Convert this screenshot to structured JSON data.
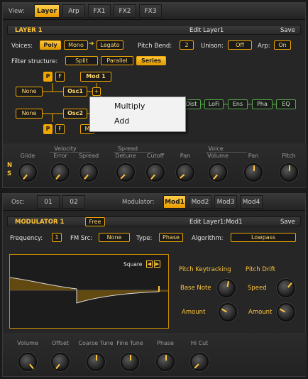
{
  "top_tabs": {
    "view_label": "View:",
    "tabs": [
      "Layer",
      "Arp",
      "FX1",
      "FX2",
      "FX3"
    ],
    "active": "Layer"
  },
  "layer": {
    "title": "LAYER 1",
    "edit_label": "Edit Layer1",
    "save": "Save",
    "voices_label": "Voices:",
    "voices": [
      "Poly",
      "Mono",
      "Legato"
    ],
    "pitch_bend_label": "Pitch Bend:",
    "pitch_bend": "2",
    "unison_label": "Unison:",
    "unison": "Off",
    "arp_label": "Arp:",
    "arp": "On",
    "filter_label": "Filter structure:",
    "filter_opts": [
      "Split",
      "Parallel",
      "Series"
    ],
    "filter_active": "Series"
  },
  "routing": {
    "p": "P",
    "f": "F",
    "mod1": "Mod 1",
    "none1": "None",
    "osc1": "Osc1",
    "plus": "+",
    "none2": "None",
    "osc2": "Osc2",
    "m": "M",
    "chain": [
      "Dist",
      "LoFi",
      "Ens",
      "Pha",
      "EQ"
    ]
  },
  "context_menu": {
    "items": [
      "Multiply",
      "Add"
    ]
  },
  "knobs1": {
    "groups": [
      "Velocity",
      "Spread",
      "Voice"
    ],
    "labels": [
      "Glide",
      "Error",
      "Spread",
      "Detune",
      "Cutoff",
      "Pan",
      "Volume",
      "Pan",
      "Pitch"
    ],
    "side": [
      "N",
      "S"
    ]
  },
  "osc_tabs": {
    "osc_label": "Osc:",
    "osc": [
      "01",
      "02"
    ],
    "mod_label": "Modulator:",
    "mods": [
      "Mod1",
      "Mod2",
      "Mod3",
      "Mod4"
    ],
    "active": "Mod1"
  },
  "modulator": {
    "title": "MODULATOR 1",
    "free": "Free",
    "edit_label": "Edit Layer1:Mod1",
    "save": "Save",
    "freq_label": "Frequency:",
    "freq": "1",
    "fm_label": "FM Src:",
    "fm": "None",
    "type_label": "Type:",
    "type": "Phase",
    "algo_label": "Algorithm:",
    "algo": "Lowpass",
    "wave": "Square",
    "pk_label": "Pitch Keytracking",
    "pd_label": "Pitch Drift",
    "base_note": "Base Note",
    "speed": "Speed",
    "amount1": "Amount",
    "amount2": "Amount"
  },
  "knobs2": {
    "labels": [
      "Volume",
      "Offset",
      "Coarse Tune",
      "Fine Tune",
      "Phase",
      "Hi Cut"
    ]
  },
  "colors": {
    "accent": "#ffc53a",
    "green": "#55a64a"
  }
}
